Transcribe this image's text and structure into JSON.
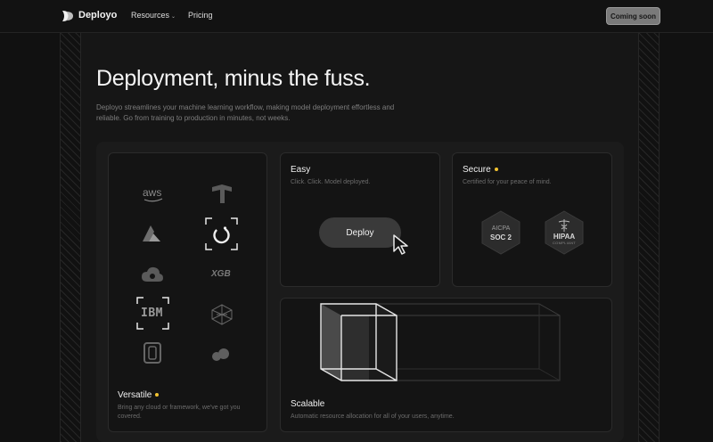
{
  "header": {
    "brand": "Deployo",
    "nav": [
      {
        "label": "Resources",
        "has_dropdown": true
      },
      {
        "label": "Pricing",
        "has_dropdown": false
      }
    ],
    "cta_label": "Coming soon"
  },
  "hero": {
    "title": "Deployment, minus the fuss.",
    "subtitle": "Deployo streamlines your machine learning workflow, making model deployment effortless and reliable. Go from training to production in minutes, not weeks."
  },
  "features": {
    "versatile": {
      "title": "Versatile",
      "description": "Bring any cloud or framework, we've got you covered.",
      "logos": [
        {
          "text": "aws",
          "icon": "aws-icon"
        },
        {
          "icon": "tensorflow-icon"
        },
        {
          "icon": "azure-icon"
        },
        {
          "icon": "pytorch-icon",
          "selected": true
        },
        {
          "icon": "google-cloud-icon"
        },
        {
          "text": "XGB",
          "icon": "xgboost-icon"
        },
        {
          "text": "IBM",
          "icon": "ibm-icon",
          "selected": true
        },
        {
          "icon": "network-icon"
        },
        {
          "icon": "scroll-icon"
        },
        {
          "icon": "cloud-blob-icon"
        }
      ]
    },
    "easy": {
      "title": "Easy",
      "description": "Click. Click. Model deployed.",
      "button_label": "Deploy"
    },
    "secure": {
      "title": "Secure",
      "description": "Certified for your peace of mind.",
      "badges": [
        {
          "line1": "AICPA",
          "line2": "SOC 2"
        },
        {
          "line1": "HIPAA",
          "line2": "COMPLIANT"
        }
      ]
    },
    "scalable": {
      "title": "Scalable",
      "description": "Automatic resource allocation for all of your users, anytime."
    }
  },
  "colors": {
    "accent_dot": "#f2c230",
    "background": "#111111",
    "card": "#141414",
    "cta_bg": "#7a7a7a"
  }
}
